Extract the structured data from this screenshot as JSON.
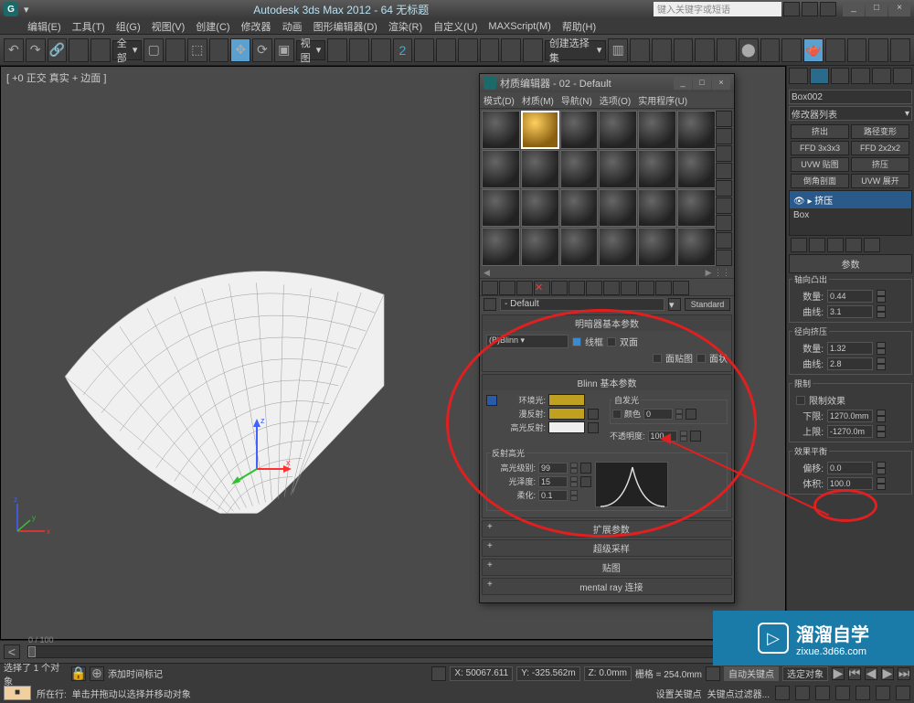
{
  "app_title": "Autodesk 3ds Max 2012 - 64    无标题",
  "search_placeholder": "键入关键字或短语",
  "menubar": [
    "编辑(E)",
    "工具(T)",
    "组(G)",
    "视图(V)",
    "创建(C)",
    "修改器",
    "动画",
    "图形编辑器(D)",
    "渲染(R)",
    "自定义(U)",
    "MAXScript(M)",
    "帮助(H)"
  ],
  "toolbar_dropdowns": {
    "filter": "全部",
    "view": "视图",
    "snap": "创建选择集"
  },
  "viewport_label": "[ +0 正交 真实 + 边面 ]",
  "right_panel": {
    "object_name": "Box002",
    "mod_list_label": "修改器列表",
    "buttons": [
      "挤出",
      "路径变形",
      "FFD 3x3x3",
      "FFD 2x2x2",
      "UVW 贴图",
      "挤压",
      "倒角剖面",
      "UVW 展开"
    ],
    "stack": [
      "挤压",
      "Box"
    ],
    "params_header": "参数",
    "groups": {
      "axial": {
        "title": "轴向凸出",
        "rows": [
          {
            "label": "数量:",
            "value": "0.44"
          },
          {
            "label": "曲线:",
            "value": "3.1"
          }
        ]
      },
      "radial": {
        "title": "径向挤压",
        "rows": [
          {
            "label": "数量:",
            "value": "1.32"
          },
          {
            "label": "曲线:",
            "value": "2.8"
          }
        ]
      },
      "limit": {
        "title": "限制",
        "check": "限制效果",
        "rows": [
          {
            "label": "下限:",
            "value": "1270.0mm"
          },
          {
            "label": "上限:",
            "value": "-1270.0m"
          }
        ]
      },
      "balance": {
        "title": "效果平衡",
        "rows": [
          {
            "label": "偏移:",
            "value": "0.0"
          },
          {
            "label": "体积:",
            "value": "100.0"
          }
        ]
      }
    }
  },
  "material_editor": {
    "title": "材质编辑器 - 02 - Default",
    "menus": [
      "模式(D)",
      "材质(M)",
      "导航(N)",
      "选项(O)",
      "实用程序(U)"
    ],
    "mat_name": "- Default",
    "mat_type": "Standard",
    "rollouts": {
      "shader_basic": {
        "title": "明暗器基本参数",
        "shader": "(B)Blinn",
        "checks": [
          "线框",
          "双面",
          "面贴图",
          "面状"
        ]
      },
      "blinn_basic": {
        "title": "Blinn 基本参数",
        "colors": {
          "ambient": "环境光:",
          "diffuse": "漫反射:",
          "specular": "高光反射:"
        },
        "self_illum": "自发光",
        "color_check": "颜色",
        "self_val": "0",
        "opacity": "不透明度:",
        "opacity_val": "100",
        "spec_hl": "反射高光",
        "spec_level": {
          "label": "高光级别:",
          "value": "99"
        },
        "gloss": {
          "label": "光泽度:",
          "value": "15"
        },
        "soften": {
          "label": "柔化:",
          "value": "0.1"
        }
      },
      "collapsed": [
        "扩展参数",
        "超级采样",
        "贴图",
        "mental ray 连接"
      ]
    }
  },
  "timeline": {
    "range": "0 / 100"
  },
  "status": {
    "selected": "选择了 1 个对象",
    "prompt": "单击并拖动以选择并移动对象",
    "coords": {
      "x": "X: 50067.611",
      "y": "Y: -325.562m",
      "z": "Z: 0.0mm"
    },
    "grid": "栅格 = 254.0mm",
    "autokey": "自动关键点",
    "selkey": "选定对象",
    "setkey": "设置关键点",
    "keyfilter": "关键点过滤器...",
    "addmarker": "添加时间标记"
  },
  "prompt_row": {
    "row_label": "所在行:"
  },
  "watermark": {
    "brand": "溜溜自学",
    "url": "zixue.3d66.com"
  }
}
